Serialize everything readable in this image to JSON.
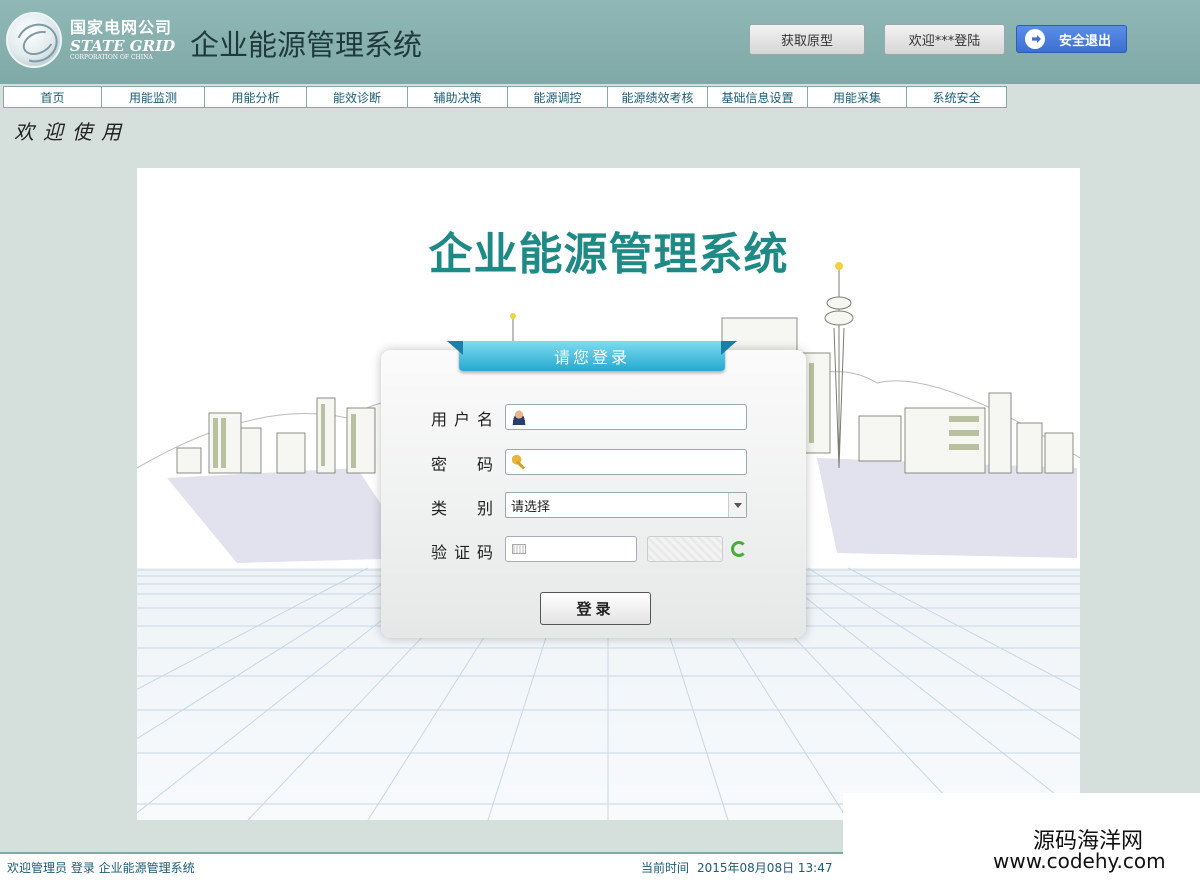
{
  "header": {
    "logo_cn": "国家电网公司",
    "logo_en": "STATE GRID",
    "logo_en2": "CORPORATION OF CHINA",
    "app_title": "企业能源管理系统",
    "btn_prototype": "获取原型",
    "btn_welcome": "欢迎***登陆",
    "btn_logout": "安全退出",
    "accent": "#7fa9a7"
  },
  "nav": {
    "items": [
      "首页",
      "用能监测",
      "用能分析",
      "能效诊断",
      "辅助决策",
      "能源调控",
      "能源绩效考核",
      "基础信息设置",
      "用能采集",
      "系统安全"
    ]
  },
  "welcome_banner": "欢迎使用",
  "main": {
    "system_title": "企业能源管理系统",
    "title_color": "#1f8a85",
    "login": {
      "ribbon": "请您登录",
      "username_label": "用户名",
      "password_label": "密 码",
      "category_label": "类 别",
      "category_value": "请选择",
      "captcha_label": "验证码",
      "submit": "登录"
    }
  },
  "footer": {
    "left": "欢迎管理员 登录 企业能源管理系统",
    "time_label": "当前时间",
    "time_value": "2015年08月08日 13:47"
  },
  "watermark": {
    "cn": "源码海洋网",
    "en": "www.codehy.com"
  }
}
